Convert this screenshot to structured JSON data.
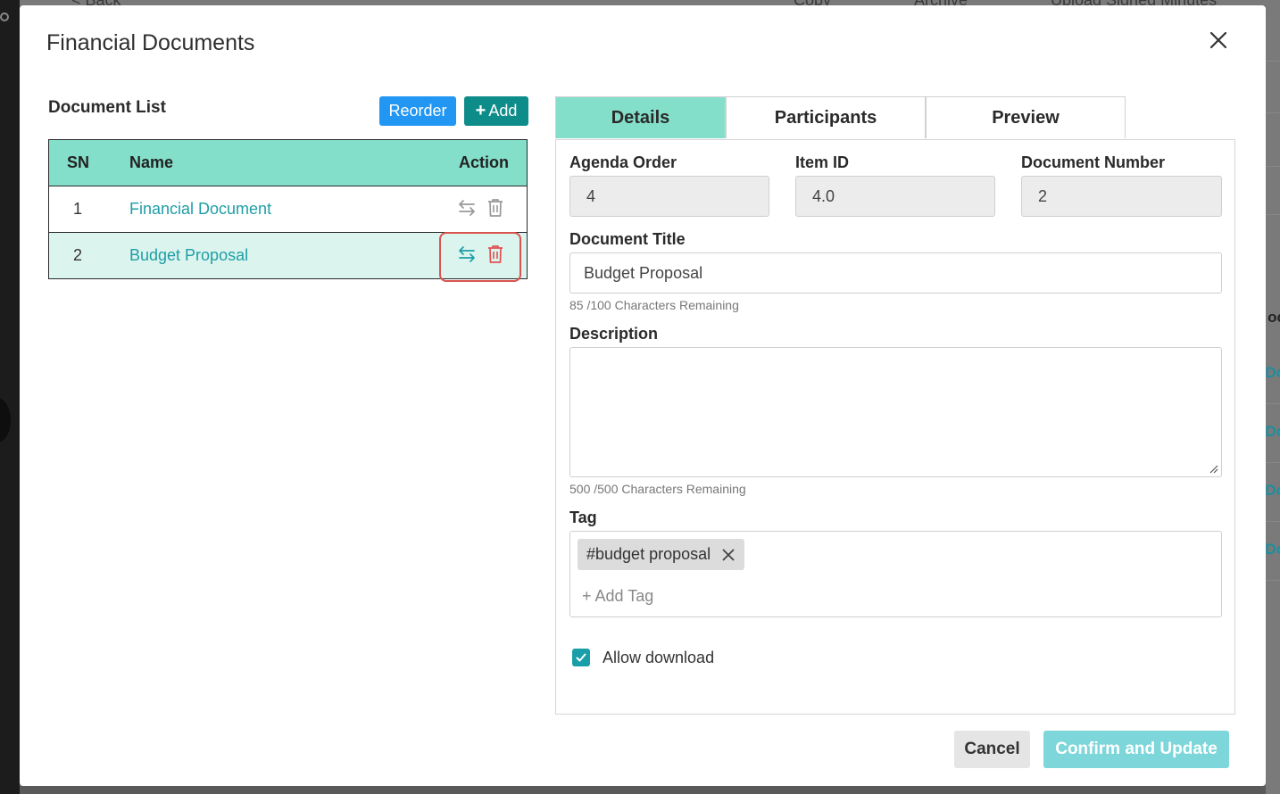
{
  "background_page": {
    "top_items": [
      "< Back",
      "Copy",
      "Archive",
      "Upload Signed Minutes"
    ],
    "right_fragments": [
      "oc",
      "Do",
      "Do",
      "Do",
      "Do"
    ]
  },
  "modal": {
    "title": "Financial Documents",
    "close_icon": "close-icon"
  },
  "document_list": {
    "heading": "Document List",
    "reorder_label": "Reorder",
    "add_label": "Add",
    "columns": {
      "sn": "SN",
      "name": "Name",
      "action": "Action"
    },
    "rows": [
      {
        "sn": "1",
        "name": "Financial Document",
        "selected": false
      },
      {
        "sn": "2",
        "name": "Budget Proposal",
        "selected": true
      }
    ],
    "action_icons": [
      "swap-icon",
      "trash-icon"
    ]
  },
  "tabs": {
    "details": "Details",
    "participants": "Participants",
    "preview": "Preview",
    "active": "Details"
  },
  "details": {
    "agenda_order_label": "Agenda Order",
    "agenda_order_value": "4",
    "item_id_label": "Item ID",
    "item_id_value": "4.0",
    "doc_number_label": "Document Number",
    "doc_number_value": "2",
    "title_label": "Document Title",
    "title_value": "Budget Proposal",
    "title_hint": "85 /100 Characters Remaining",
    "description_label": "Description",
    "description_value": "",
    "description_hint": "500 /500 Characters Remaining",
    "tag_label": "Tag",
    "tags": [
      "#budget proposal"
    ],
    "add_tag_placeholder": "+ Add Tag",
    "allow_download_label": "Allow download",
    "allow_download_checked": true
  },
  "footer": {
    "cancel_label": "Cancel",
    "confirm_label": "Confirm and Update"
  },
  "colors": {
    "header_teal": "#84dfca",
    "selected_row": "#dcf4ee",
    "link_teal": "#1e9ea6",
    "reorder_blue": "#2196f3",
    "add_teal": "#0e8c8a",
    "confirm_disabled": "#7dd6d9",
    "highlight_red": "#d9534f"
  }
}
